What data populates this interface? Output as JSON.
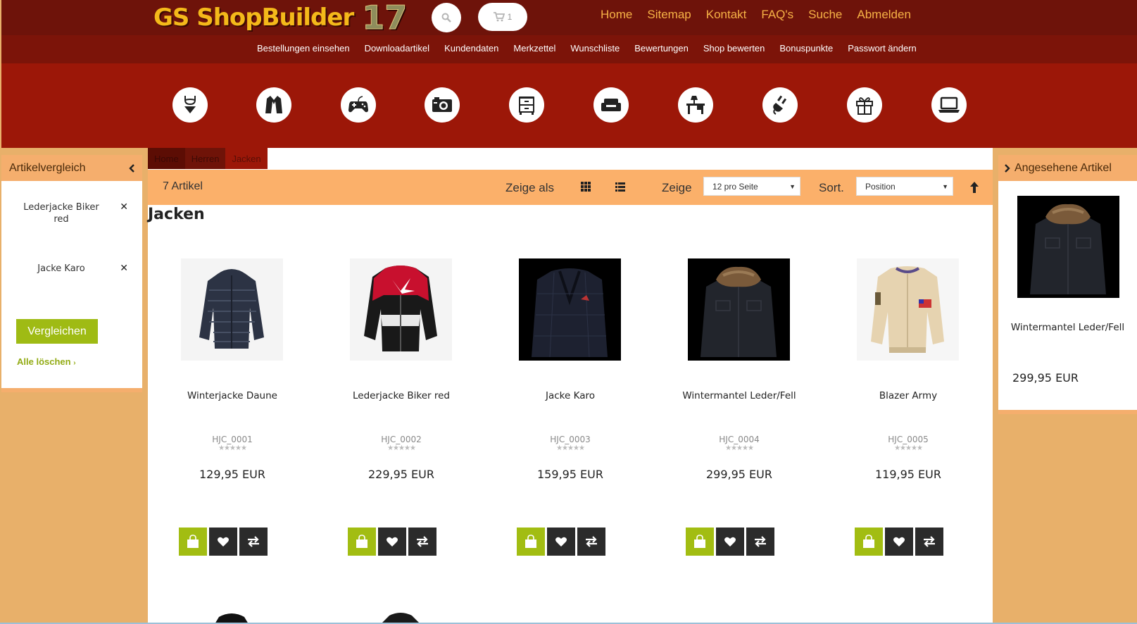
{
  "header": {
    "logo_text": "GS ShopBuilder",
    "logo_version": "17",
    "cart_count": "1",
    "nav": [
      "Home",
      "Sitemap",
      "Kontakt",
      "FAQ's",
      "Suche",
      "Abmelden"
    ]
  },
  "account_nav": [
    "Bestellungen einsehen",
    "Downloadartikel",
    "Kundendaten",
    "Merkzettel",
    "Wunschliste",
    "Bewertungen",
    "Shop bewerten",
    "Bonuspunkte",
    "Passwort ändern"
  ],
  "categories": [
    "lingerie-icon",
    "coat-icon",
    "gamepad-icon",
    "camera-icon",
    "dresser-icon",
    "sofa-icon",
    "desk-lamp-icon",
    "plug-icon",
    "gift-icon",
    "laptop-icon"
  ],
  "compare": {
    "title": "Artikelvergleich",
    "items": [
      "Lederjacke Biker red",
      "Jacke Karo"
    ],
    "button": "Vergleichen",
    "clear": "Alle löschen"
  },
  "breadcrumb": [
    "Home",
    "Herren",
    "Jacken"
  ],
  "toolbar": {
    "count": "7 Artikel",
    "view_label": "Zeige als",
    "show_label": "Zeige",
    "per_page": "12 pro Seite",
    "sort_label": "Sort.",
    "sort_value": "Position"
  },
  "page_title": "Jacken",
  "products": [
    {
      "name": "Winterjacke Daune",
      "sku": "HJC_0001",
      "price": "129,95 EUR",
      "rating": 0
    },
    {
      "name": "Lederjacke Biker red",
      "sku": "HJC_0002",
      "price": "229,95 EUR",
      "rating": 0
    },
    {
      "name": "Jacke Karo",
      "sku": "HJC_0003",
      "price": "159,95 EUR",
      "rating": 0
    },
    {
      "name": "Wintermantel Leder/Fell",
      "sku": "HJC_0004",
      "price": "299,95 EUR",
      "rating": 0
    },
    {
      "name": "Blazer Army",
      "sku": "HJC_0005",
      "price": "119,95 EUR",
      "rating": 0
    }
  ],
  "viewed": {
    "title": "Angesehene Artikel",
    "name": "Wintermantel Leder/Fell",
    "price": "299,95 EUR"
  },
  "colors": {
    "topbar": "#6e130a",
    "subbar": "#7c1409",
    "band": "#9c1708",
    "accent": "#a2bd12",
    "nav_link": "#f6b246",
    "toolbar": "#fbb06a"
  }
}
